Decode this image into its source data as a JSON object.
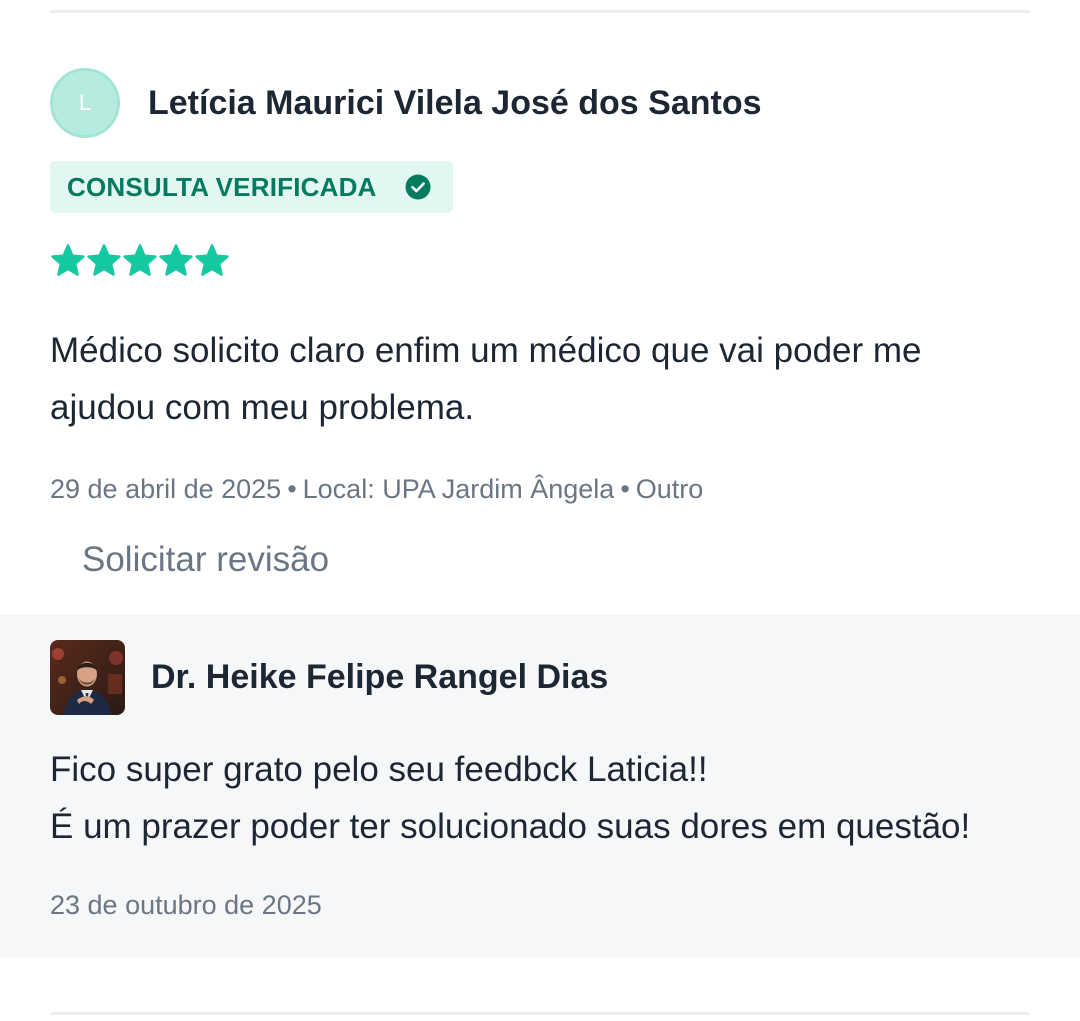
{
  "review": {
    "reviewer_initial": "L",
    "reviewer_name": "Letícia Maurici Vilela José dos Santos",
    "verified_label": "CONSULTA VERIFICADA",
    "rating": 5,
    "rating_max": 5,
    "text": "Médico solicito claro enfim um médico que vai poder me ajudou com meu problema.",
    "date": "29 de abril de 2025",
    "separator": "•",
    "location": "Local: UPA Jardim Ângela",
    "category": "Outro",
    "request_review_label": "Solicitar revisão"
  },
  "reply": {
    "doctor_name": "Dr. Heike Felipe Rangel Dias",
    "text_line_1": "Fico super grato pelo seu feedbck Laticia!!",
    "text_line_2": "É um prazer poder ter solucionado suas dores em questão!",
    "date": "23 de outubro de 2025"
  },
  "colors": {
    "star": "#14c8a0",
    "badge_bg": "#e2f6f2",
    "badge_text": "#047a5f",
    "avatar_bg": "#b6ece0",
    "muted_text": "#6b7684",
    "reply_bg": "#f6f7f9"
  },
  "icons": {
    "verified": "check-circle-icon",
    "rating": "star-icon"
  }
}
